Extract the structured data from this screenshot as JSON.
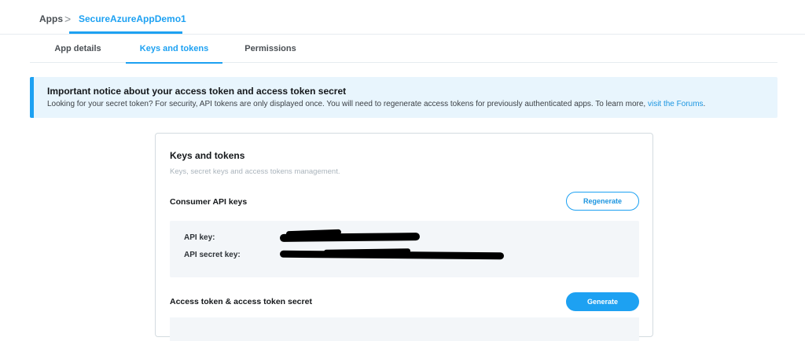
{
  "breadcrumb": {
    "root": "Apps",
    "separator": ">",
    "current": "SecureAzureAppDemo1"
  },
  "tabs": [
    {
      "label": "App details",
      "active": false
    },
    {
      "label": "Keys and tokens",
      "active": true
    },
    {
      "label": "Permissions",
      "active": false
    }
  ],
  "notice": {
    "title": "Important notice about your access token and access token secret",
    "text": "Looking for your secret token? For security, API tokens are only displayed once. You will need to regenerate access tokens for previously authenticated apps. To learn more, ",
    "link": "visit the Forums",
    "suffix": "."
  },
  "card": {
    "title": "Keys and tokens",
    "subtitle": "Keys, secret keys and access tokens management.",
    "consumer": {
      "title": "Consumer API keys",
      "button": "Regenerate",
      "api_key_label": "API key:",
      "api_key_value": "",
      "api_secret_label": "API secret key:",
      "api_secret_value": ""
    },
    "access": {
      "title": "Access token & access token secret",
      "button": "Generate"
    }
  },
  "colors": {
    "accent": "#1da1f2",
    "notice_bg": "#e8f5fd",
    "keys_bg": "#f3f6f9"
  }
}
